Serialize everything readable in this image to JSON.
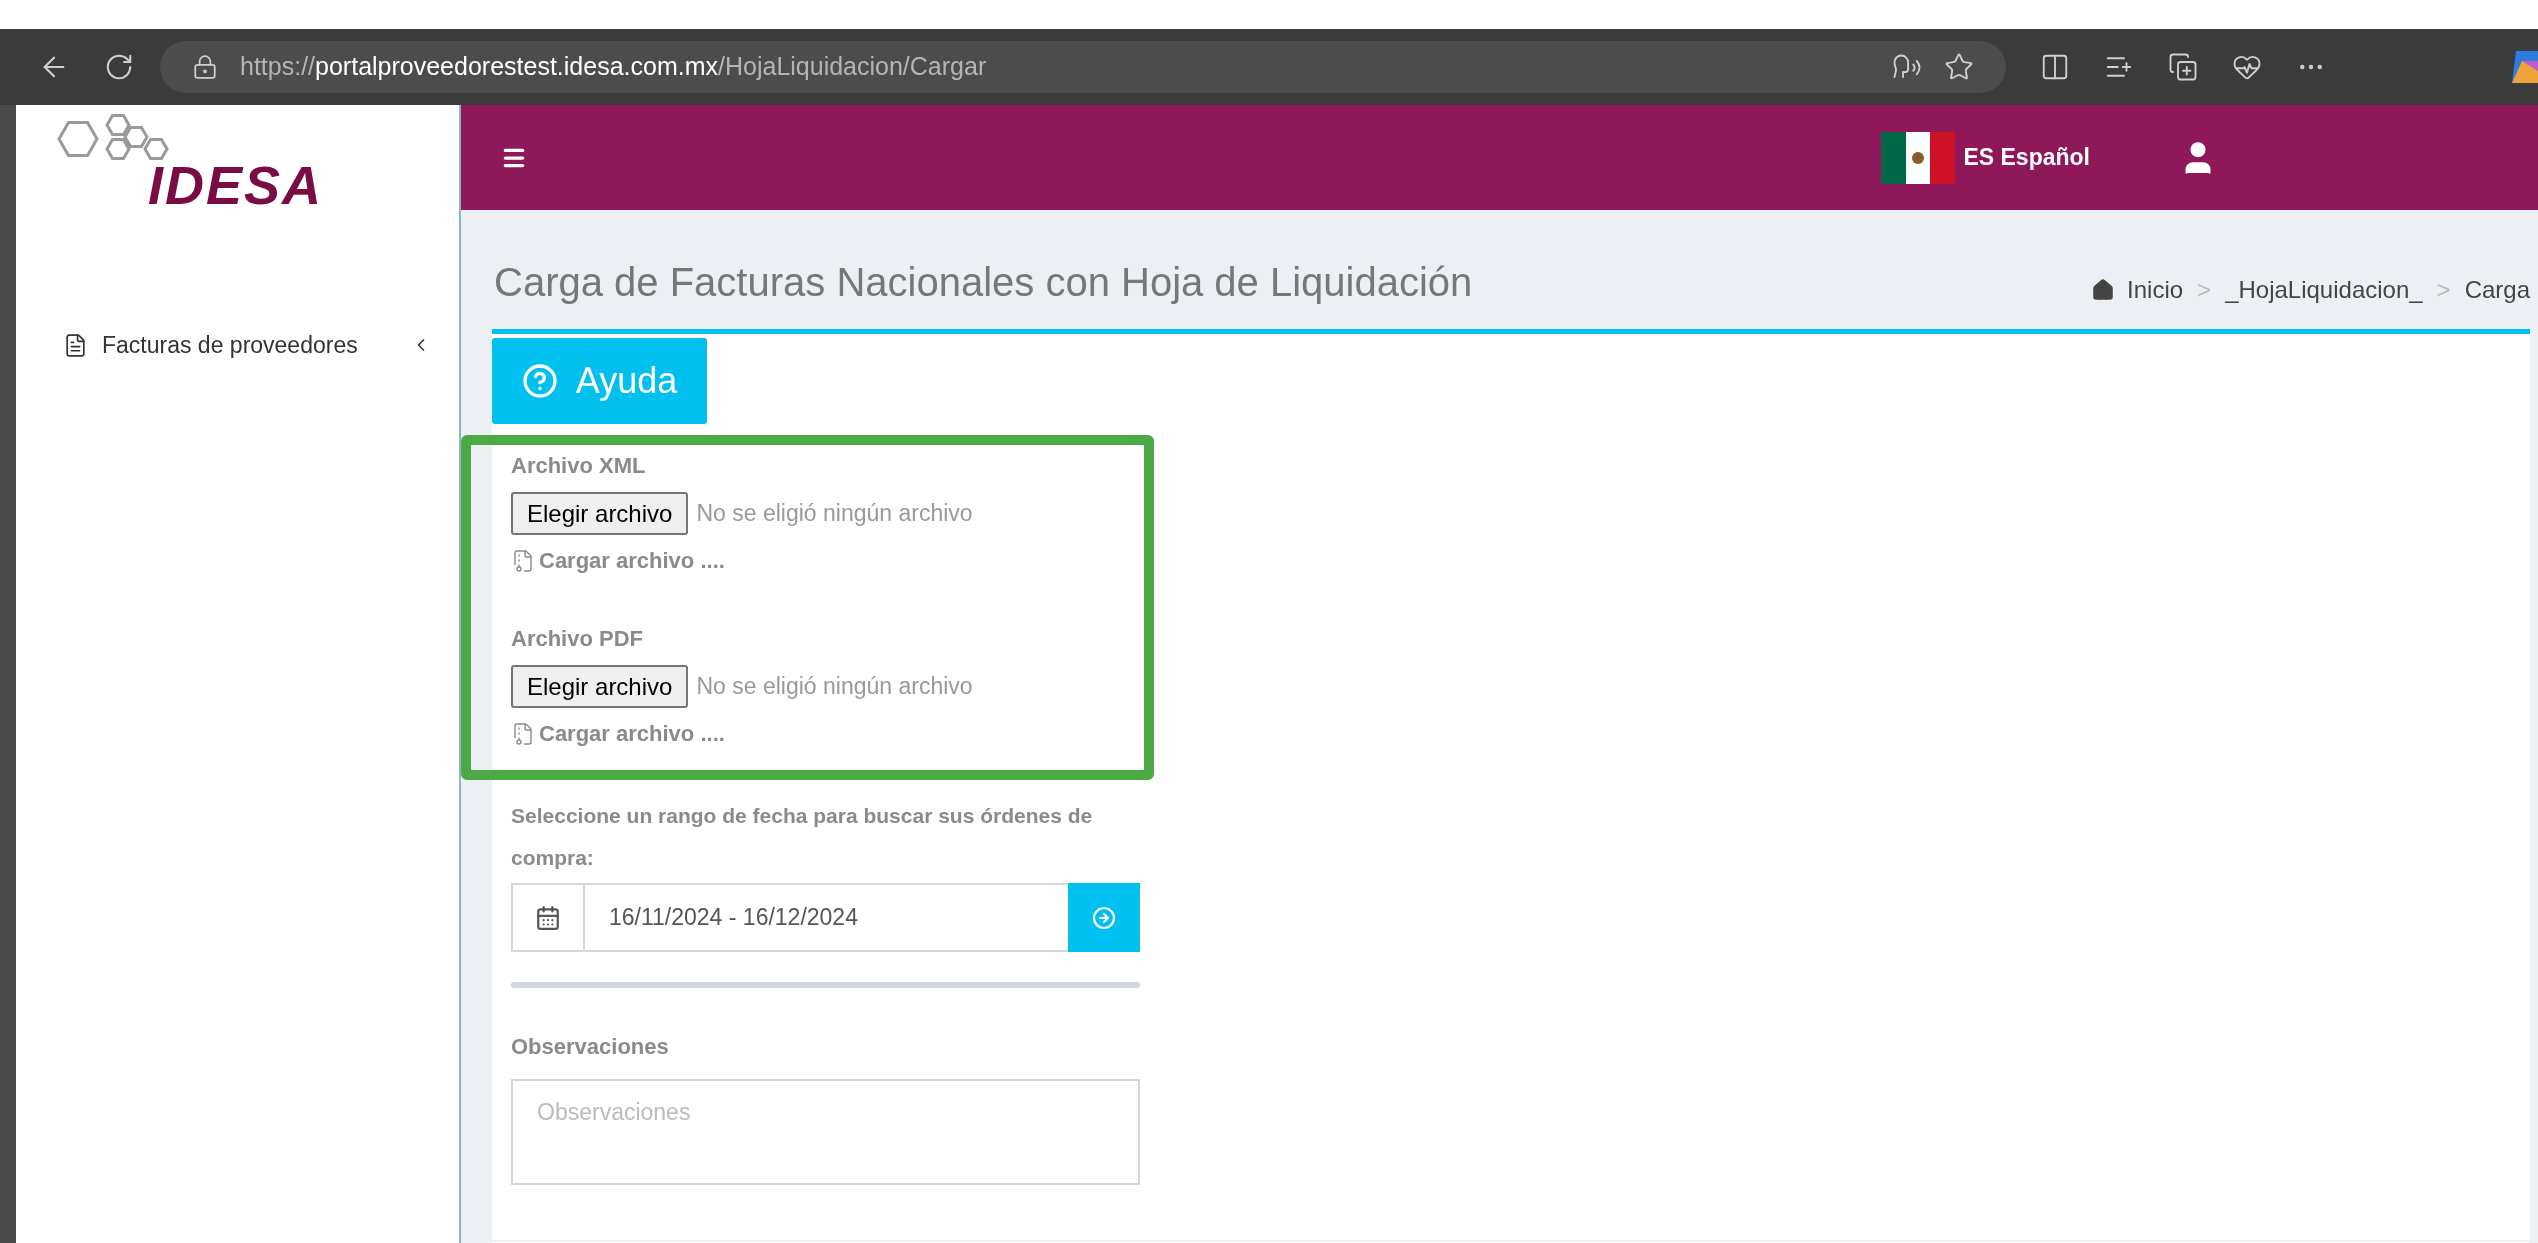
{
  "browser": {
    "url": "https://**portalproveedorestest.idesa.com.mx**/HojaLiquidacion/Cargar"
  },
  "sidebar": {
    "logo": "IDESA",
    "items": [
      {
        "label": "Facturas de proveedores",
        "expanded": false
      }
    ]
  },
  "header": {
    "language": "ES Español"
  },
  "page": {
    "title": "Carga de Facturas Nacionales con Hoja de Liquidación",
    "breadcrumb": [
      {
        "kind": "home",
        "label": "Inicio"
      },
      {
        "kind": "separator",
        "label": ">"
      },
      {
        "kind": "link",
        "label": "_HojaLiquidacion_"
      },
      {
        "kind": "separator",
        "label": ">"
      },
      {
        "kind": "current",
        "label": "Carga"
      }
    ]
  },
  "help_button": "Ayuda",
  "file_fields": [
    {
      "label": "Archivo XML",
      "button": "Elegir archivo",
      "status": "No se eligió ningún archivo",
      "upload_link": "Cargar archivo ...."
    },
    {
      "label": "Archivo PDF",
      "button": "Elegir archivo",
      "status": "No se eligió ningún archivo",
      "upload_link": "Cargar archivo ...."
    }
  ],
  "date_range": {
    "label": "Seleccione un rango de fecha para buscar sus órdenes de compra:",
    "value": "16/11/2024 - 16/12/2024"
  },
  "notes": {
    "label": "Observaciones",
    "placeholder": "Observaciones"
  }
}
